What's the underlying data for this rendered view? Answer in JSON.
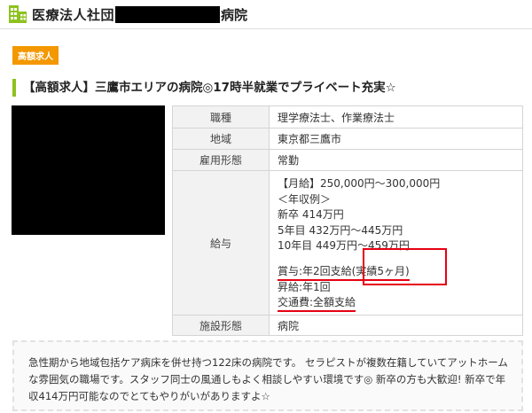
{
  "header": {
    "org_prefix": "医療法人社団",
    "org_suffix": "病院",
    "icon": "building-icon",
    "accent_color": "#8dc21f"
  },
  "badge": {
    "label": "高額求人",
    "color": "#f39800"
  },
  "job_title": "【高額求人】三鷹市エリアの病院◎17時半就業でプライベート充実☆",
  "table": {
    "rows": [
      {
        "label": "職種",
        "value": "理学療法士、作業療法士"
      },
      {
        "label": "地域",
        "value": "東京都三鷹市"
      },
      {
        "label": "雇用形態",
        "value": "常勤"
      },
      {
        "label": "給与",
        "lines": [
          "【月給】250,000円～300,000円",
          "＜年収例＞",
          "新卒 414万円",
          "5年目 432万円～445万円",
          "10年目 449万円～459万円",
          "",
          "賞与:年2回支給(実績5ヶ月)",
          "昇給:年1回",
          "交通費:全額支給"
        ]
      },
      {
        "label": "施設形態",
        "value": "病院"
      }
    ],
    "highlight_color": "#e60012"
  },
  "description": "急性期から地域包括ケア病床を併せ持つ122床の病院です。 セラピストが複数在籍していてアットホームな雰囲気の職場です。スタッフ同士の風通しもよく相談しやすい環境です◎ 新卒の方も大歓迎! 新卒で年収414万円可能なのでとてもやりがいがありますよ☆"
}
